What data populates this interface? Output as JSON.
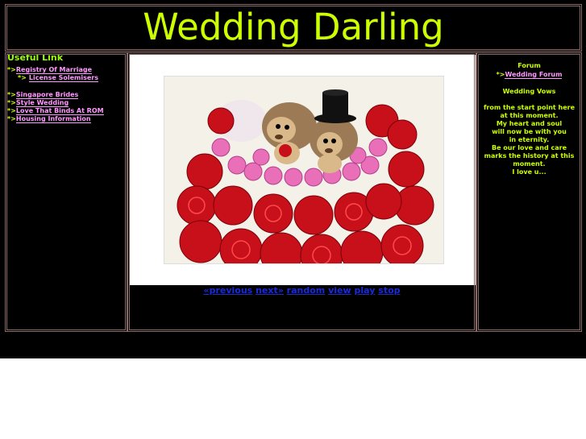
{
  "header": {
    "title": "Wedding Darling"
  },
  "left": {
    "heading": "Useful Link",
    "star": "*>",
    "items": [
      {
        "label": "Registry Of Marriage"
      },
      {
        "label": "License Solemisers"
      },
      {
        "label": "Singapore Brides"
      },
      {
        "label": "Style Wedding"
      },
      {
        "label": "Love That Binds At ROM"
      },
      {
        "label": "Housing Information"
      }
    ]
  },
  "center": {
    "controls": {
      "previous": "«previous",
      "next": "next»",
      "random": "random",
      "view": "view",
      "play": "play",
      "stop": "stop"
    }
  },
  "right": {
    "forum_heading": "Forum",
    "forum_link": "Wedding Forum",
    "star": "*>",
    "vows_heading": "Wedding Vows",
    "vows_lines": [
      "from the start point here",
      "at this moment.",
      "My heart and soul",
      "will now be with you",
      "in eternity.",
      "Be our love and care",
      "marks the history at this",
      "moment.",
      "I love u..."
    ]
  },
  "colors": {
    "title": "#ccff00",
    "link": "#ff99ff",
    "background": "#000000",
    "control_link": "#1a2bd8"
  }
}
